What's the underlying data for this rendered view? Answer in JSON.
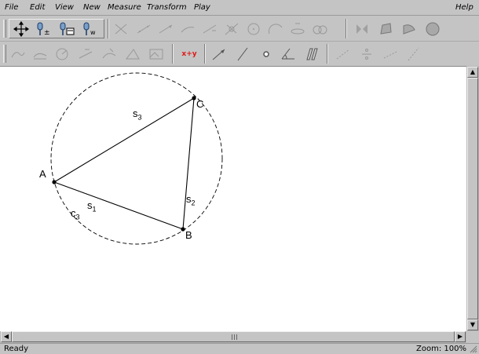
{
  "menubar": {
    "items": [
      "File",
      "Edit",
      "View",
      "New",
      "Measure",
      "Transform",
      "Play"
    ],
    "help": "Help"
  },
  "toolbar2": {
    "coordinate_button_label": "x+y"
  },
  "canvas": {
    "points": {
      "A": {
        "label": "A"
      },
      "B": {
        "label": "B"
      },
      "C": {
        "label": "C"
      }
    },
    "segments": {
      "s1": {
        "base": "s",
        "sub": "1"
      },
      "s2": {
        "base": "s",
        "sub": "2"
      },
      "s3": {
        "base": "s",
        "sub": "3"
      }
    },
    "circle": {
      "base": "c",
      "sub": "3"
    }
  },
  "statusbar": {
    "status": "Ready",
    "zoom": "Zoom: 100%"
  },
  "icons": [
    "move-icon",
    "pointer-add-icon",
    "pointer-save-icon",
    "pointer-value-icon"
  ]
}
